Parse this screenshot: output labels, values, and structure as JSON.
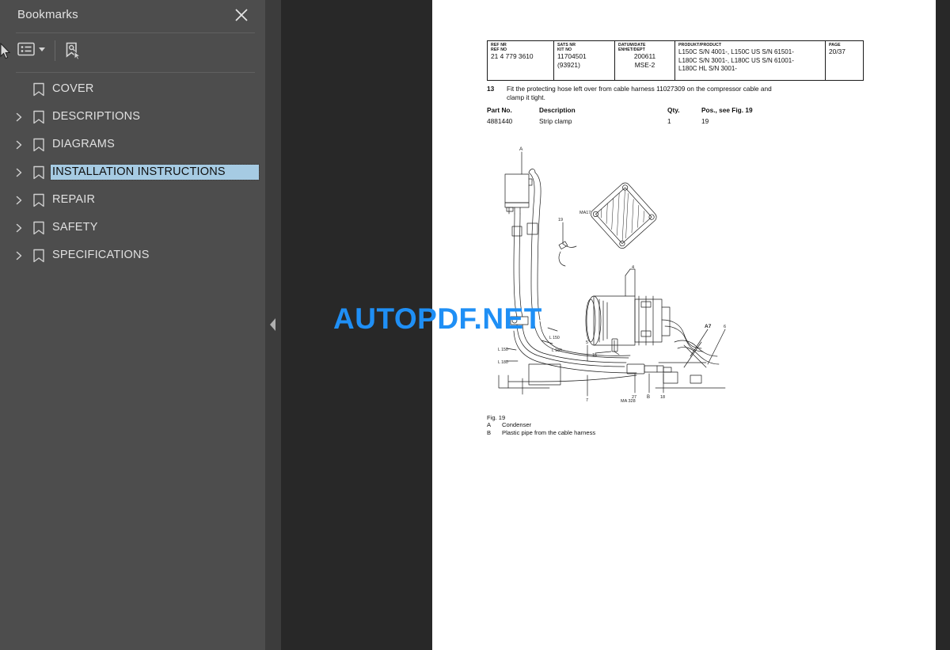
{
  "sidebar": {
    "title": "Bookmarks",
    "close_label": "close-icon",
    "toolbar": {
      "list_options_label": "list-options-icon",
      "find_bookmark_label": "find-bookmark-icon"
    },
    "items": [
      {
        "label": "COVER",
        "expandable": false,
        "selected": false
      },
      {
        "label": "DESCRIPTIONS",
        "expandable": true,
        "selected": false
      },
      {
        "label": "DIAGRAMS",
        "expandable": true,
        "selected": false
      },
      {
        "label": "INSTALLATION INSTRUCTIONS",
        "expandable": true,
        "selected": true
      },
      {
        "label": "REPAIR",
        "expandable": true,
        "selected": false
      },
      {
        "label": "SAFETY",
        "expandable": true,
        "selected": false
      },
      {
        "label": "SPECIFICATIONS",
        "expandable": true,
        "selected": false
      }
    ]
  },
  "splitter": {
    "collapse_label": "collapse-sidebar-arrow"
  },
  "document": {
    "header_table": {
      "ref": {
        "head_line1": "REF NR",
        "head_line2": "REF NO",
        "value": "21 4 779 3610"
      },
      "kit": {
        "head_line1": "SATS NR",
        "head_line2": "KIT NO",
        "value_line1": "11704501",
        "value_line2": "(93921)"
      },
      "date": {
        "head_line1": "DATUM/DATE",
        "head_line2": "ENHET/DEPT",
        "value_line1": "200611",
        "value_line2": "MSE-2"
      },
      "product": {
        "head": "PRODUKT/PRODUCT",
        "value_line1": "L150C S/N 4001-, L150C US S/N 61501-",
        "value_line2": "L180C S/N 3001-, L180C US S/N 61001-",
        "value_line3": "L180C HL S/N 3001-"
      },
      "page": {
        "head": "PAGE",
        "value": "20/37"
      }
    },
    "instruction": {
      "number": "13",
      "text": "Fit the protecting hose left over from cable harness 11027309 on the compressor cable and clamp it tight."
    },
    "parts_table": {
      "headers": [
        "Part No.",
        "Description",
        "Qty.",
        "Pos., see Fig. 19"
      ],
      "rows": [
        [
          "4881440",
          "Strip clamp",
          "1",
          "19"
        ]
      ]
    },
    "figure": {
      "caption_title": "Fig. 19",
      "legend": [
        {
          "key": "A",
          "text": "Condenser"
        },
        {
          "key": "B",
          "text": "Plastic pipe from the cable harness"
        }
      ],
      "callouts": [
        "A",
        "19",
        "MA17",
        "4",
        "L 150",
        "L 180",
        "L 150",
        "L 180",
        "5",
        "15",
        "7",
        "B",
        "27",
        "18",
        "A7",
        "6",
        "MA 328"
      ]
    }
  },
  "watermark": {
    "text": "AUTOPDF.NET",
    "color": "#1f8ff5"
  },
  "theme": {
    "sidebar_bg": "#4d4d4d",
    "splitter_bg": "#3c3c3c",
    "viewer_bg": "#282828",
    "page_bg": "#ffffff",
    "selection_bg": "#a6cbe3",
    "text_color": "#e0e0e0"
  }
}
